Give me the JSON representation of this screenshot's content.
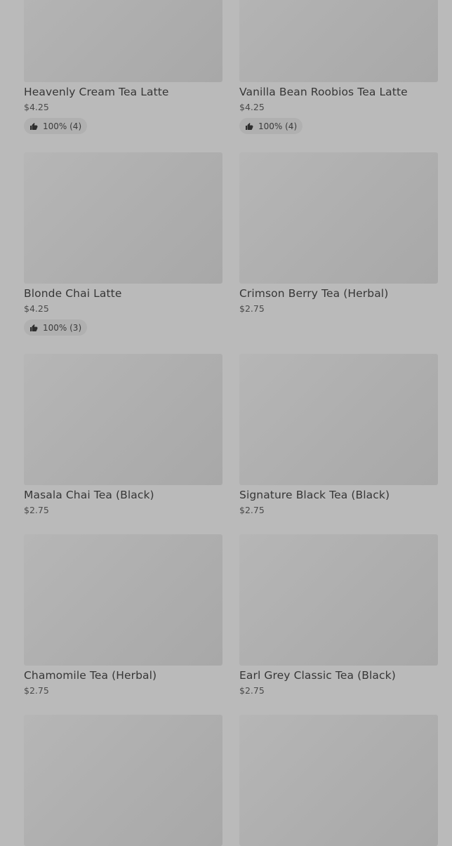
{
  "products": [
    {
      "name": "Heavenly Cream Tea Latte",
      "price": "$4.25",
      "rating": "100% (4)"
    },
    {
      "name": "Vanilla Bean Roobios Tea Latte",
      "price": "$4.25",
      "rating": "100% (4)"
    },
    {
      "name": "Blonde Chai Latte",
      "price": "$4.25",
      "rating": "100% (3)"
    },
    {
      "name": "Crimson Berry Tea (Herbal)",
      "price": "$2.75",
      "rating": ""
    },
    {
      "name": "Masala Chai Tea (Black)",
      "price": "$2.75",
      "rating": ""
    },
    {
      "name": "Signature Black Tea (Black)",
      "price": "$2.75",
      "rating": ""
    },
    {
      "name": "Chamomile Tea (Herbal)",
      "price": "$2.75",
      "rating": ""
    },
    {
      "name": "Earl Grey Classic Tea (Black)",
      "price": "$2.75",
      "rating": ""
    },
    {
      "name": "",
      "price": "",
      "rating": ""
    },
    {
      "name": "",
      "price": "",
      "rating": ""
    }
  ],
  "icons": {
    "rating": "thumbs-up-icon"
  }
}
